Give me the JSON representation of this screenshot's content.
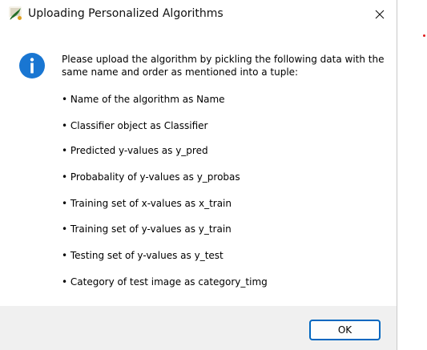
{
  "window": {
    "title": "Uploading Personalized Algorithms",
    "app_icon": "python-tkinter-feather-icon",
    "close_icon": "close-icon"
  },
  "message": {
    "icon": "info-icon",
    "intro": "Please upload the algorithm by pickling the following data with the same name and order as mentioned into a tuple:",
    "bullets": [
      "• Name of the algorithm as Name",
      "• Classifier object as Classifier",
      "• Predicted y-values as y_pred",
      "• Probabality of y-values as y_probas",
      "• Training set of x-values as x_train",
      "• Training set of y-values as y_train",
      "• Testing set of y-values as y_test",
      "• Category of test image as category_timg"
    ]
  },
  "footer": {
    "ok_label": "OK"
  },
  "colors": {
    "info_icon": "#1976d2",
    "ok_border": "#0067c0",
    "footer_bg": "#f0f0f0"
  }
}
